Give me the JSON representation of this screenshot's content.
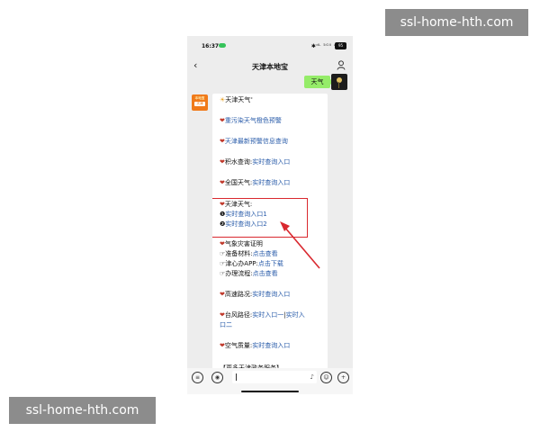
{
  "watermark": {
    "top": "ssl-home-hth.com",
    "bottom": "ssl-home-hth.com"
  },
  "status_bar": {
    "time": "16:37",
    "icons": "✱ᵈᴸ ⁵ᴳᴵˡ ᵃ",
    "battery": "95"
  },
  "nav": {
    "back_icon": "chevron-left",
    "title": "天津本地宝",
    "profile_icon": "person"
  },
  "user_message": {
    "text": "天气"
  },
  "bot": {
    "avatar_line1": "本地宝",
    "avatar_line2": "天津",
    "title_line": "天津天气",
    "items": {
      "warning": "重污染天气橙色预警",
      "query": "天津最新预警信息查询",
      "water_label": "积水查询:",
      "water_link": "实时查询入口",
      "national_label": "全国天气:",
      "national_link": "实时查询入口",
      "tianjin_label": "天津天气:",
      "entry1": "实时查询入口1",
      "entry2": "实时查询入口2",
      "disaster_title": "气象灾害证明",
      "prep_label": "准备材料:",
      "prep_link": "点击查看",
      "app_label": "津心办APP:",
      "app_link": "点击下载",
      "process_label": "办理流程:",
      "process_link": "点击查看",
      "road_label": "高速路况:",
      "road_link": "实时查询入口",
      "typhoon_label": "台风路径:",
      "typhoon_link1": "实时入口一",
      "typhoon_sep": "|",
      "typhoon_link2a": "实时入",
      "typhoon_link2b": "口二",
      "air_label": "空气质量:",
      "air_link": "实时查询入口",
      "cut_text": "【更多天津政务服务】"
    }
  },
  "colors": {
    "accent_red": "#d9282f",
    "link_blue": "#2a5caa",
    "bubble_green": "#95ec69"
  }
}
